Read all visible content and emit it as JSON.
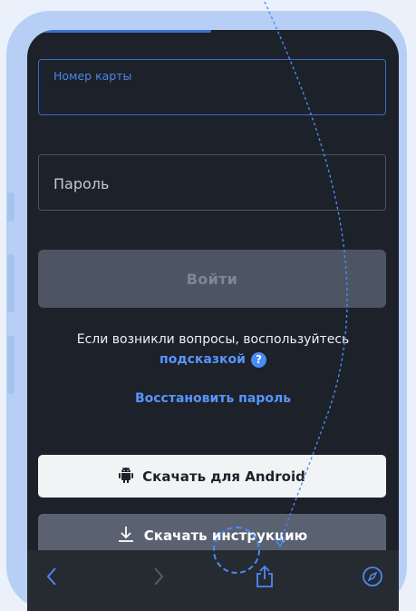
{
  "login_form": {
    "card_number_label": "Номер карты",
    "card_number_value": "",
    "password_placeholder": "Пароль",
    "login_button": "Войти"
  },
  "help": {
    "text": "Если возникли вопросы, воспользуйтесь",
    "link": "подсказкой",
    "icon": "question-icon"
  },
  "restore_password": "Восстановить пароль",
  "downloads": {
    "android_label": "Скачать для Android",
    "android_icon": "android-icon",
    "instruction_label": "Скачать инструкцию",
    "instruction_icon": "download-icon"
  },
  "browser_toolbar": {
    "icons": [
      "back-icon",
      "forward-icon",
      "share-icon",
      "compass-icon"
    ]
  },
  "colors": {
    "accent": "#4a8bf4",
    "screen_bg": "#1d2129",
    "frame": "#b7cff5"
  }
}
